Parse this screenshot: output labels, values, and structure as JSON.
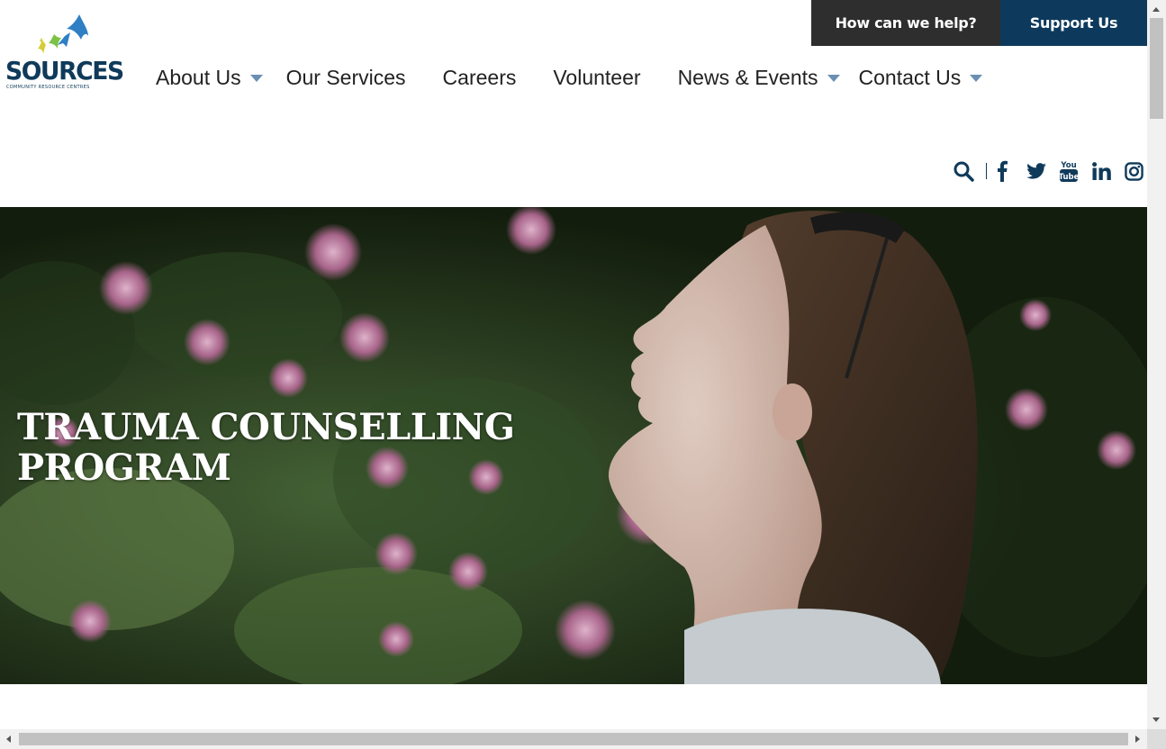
{
  "utility": {
    "help_label": "How can we help?",
    "support_label": "Support Us"
  },
  "logo": {
    "wordmark": "SOURCES",
    "tagline": "COMMUNITY RESOURCE CENTRES"
  },
  "nav": {
    "items": [
      {
        "label": "About Us",
        "has_dropdown": true
      },
      {
        "label": "Our Services",
        "has_dropdown": false
      },
      {
        "label": "Careers",
        "has_dropdown": false
      },
      {
        "label": "Volunteer",
        "has_dropdown": false
      },
      {
        "label": "News & Events",
        "has_dropdown": true
      },
      {
        "label": "Contact Us",
        "has_dropdown": true
      }
    ]
  },
  "social": {
    "icons": [
      "search-icon",
      "facebook-icon",
      "twitter-icon",
      "youtube-icon",
      "linkedin-icon",
      "instagram-icon"
    ],
    "color": "#0f3a5a"
  },
  "hero": {
    "title_line1": "TRAUMA COUNSELLING",
    "title_line2": "PROGRAM"
  },
  "colors": {
    "help_bg": "#2e2e2e",
    "support_bg": "#0d3a5c",
    "brand_navy": "#0f3a5a",
    "caret": "#6b8fb3"
  }
}
